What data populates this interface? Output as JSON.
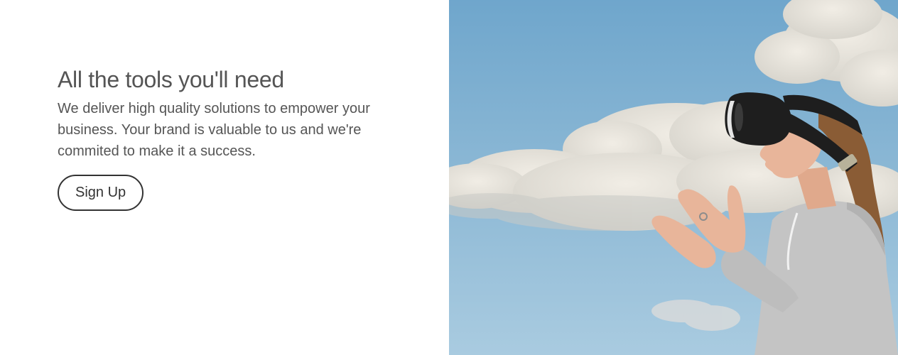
{
  "hero": {
    "title": "All the tools you'll need",
    "description": "We deliver high quality solutions to empower your business. Your brand is valuable to us and we're commited to make it a success.",
    "cta_label": "Sign Up"
  },
  "image": {
    "subject": "person-wearing-vr-headset-sky",
    "colors": {
      "sky_top": "#6fa6cc",
      "sky_bottom": "#a9cbe0",
      "cloud": "#e7e4dc",
      "hoodie": "#c4c4c4",
      "skin": "#e8b59a",
      "headset": "#1e1e1e",
      "hair": "#8a5c35"
    }
  }
}
